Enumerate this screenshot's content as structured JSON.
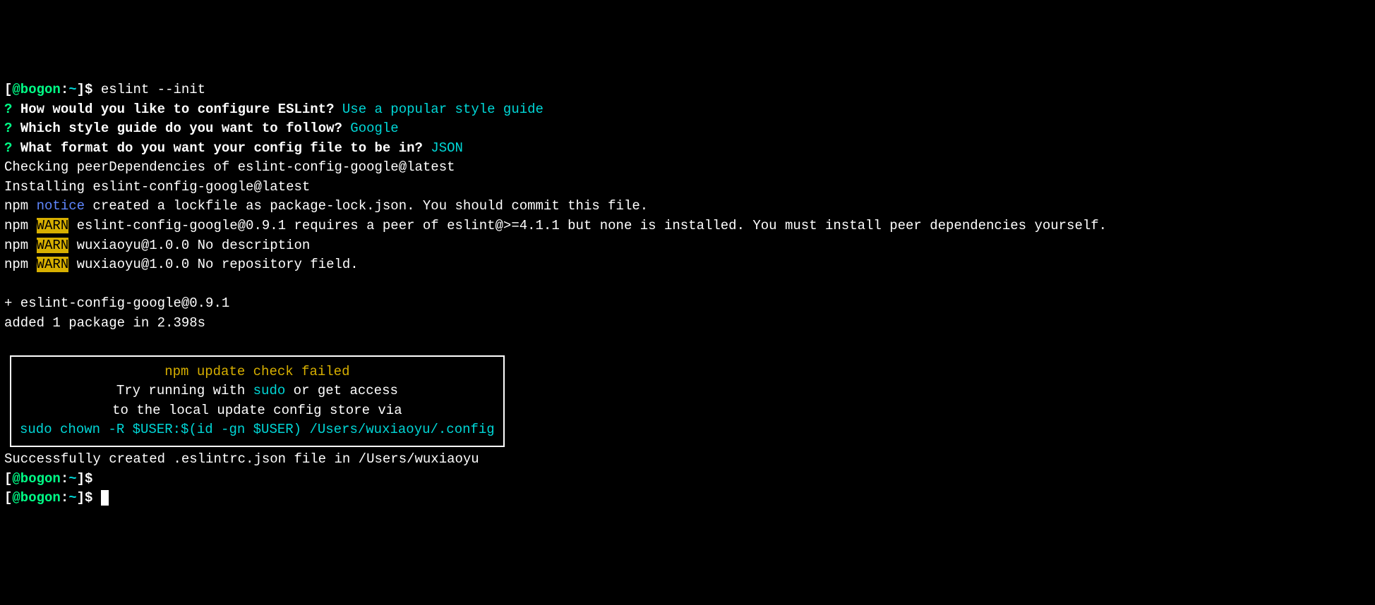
{
  "prompt": {
    "bracket_open": "[",
    "user_host": "@bogon",
    "colon": ":",
    "path": "~",
    "bracket_close": "]",
    "dollar": "$"
  },
  "line1": {
    "command": " eslint --init"
  },
  "line2": {
    "q": "? ",
    "question": "How would you like to configure ESLint? ",
    "answer": "Use a popular style guide"
  },
  "line3": {
    "q": "? ",
    "question": "Which style guide do you want to follow? ",
    "answer": "Google"
  },
  "line4": {
    "q": "? ",
    "question": "What format do you want your config file to be in? ",
    "answer": "JSON"
  },
  "line5": "Checking peerDependencies of eslint-config-google@latest",
  "line6": "Installing eslint-config-google@latest",
  "line7": {
    "npm": "npm ",
    "notice": "notice",
    "rest": " created a lockfile as package-lock.json. You should commit this file."
  },
  "line8": {
    "npm": "npm ",
    "warn": "WARN",
    "rest": " eslint-config-google@0.9.1 requires a peer of eslint@>=4.1.1 but none is installed. You must install peer dependencies yourself."
  },
  "line9": {
    "npm": "npm ",
    "warn": "WARN",
    "rest": " wuxiaoyu@1.0.0 No description"
  },
  "line10": {
    "npm": "npm ",
    "warn": "WARN",
    "rest": " wuxiaoyu@1.0.0 No repository field."
  },
  "line12": "+ eslint-config-google@0.9.1",
  "line13": "added 1 package in 2.398s",
  "box": {
    "l1": "npm update check failed",
    "l2a": "Try running with ",
    "l2b": "sudo",
    "l2c": " or get access",
    "l3": "to the local update config store via",
    "l4": "sudo chown -R $USER:$(id -gn $USER) /Users/wuxiaoyu/.config"
  },
  "line_success": "Successfully created .eslintrc.json file in /Users/wuxiaoyu"
}
